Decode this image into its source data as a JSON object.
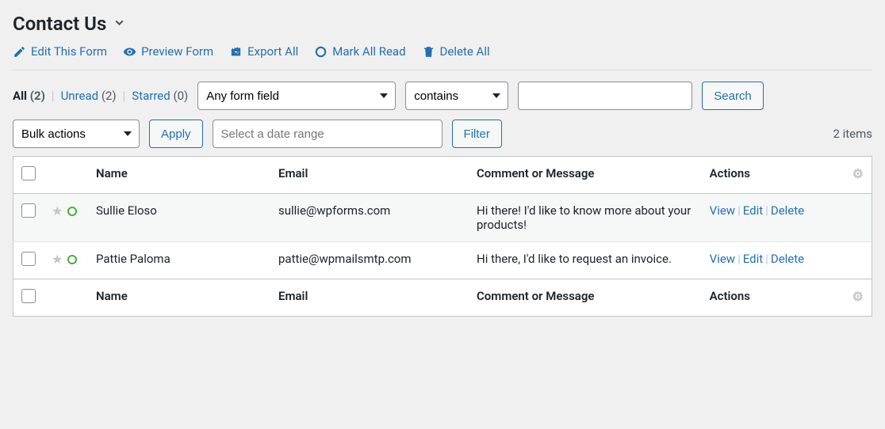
{
  "header": {
    "title": "Contact Us"
  },
  "toolbar": {
    "edit": "Edit This Form",
    "preview": "Preview Form",
    "export": "Export All",
    "mark_read": "Mark All Read",
    "delete_all": "Delete All"
  },
  "status": {
    "all_label": "All",
    "all_count": "(2)",
    "unread_label": "Unread",
    "unread_count": "(2)",
    "starred_label": "Starred",
    "starred_count": "(0)"
  },
  "search": {
    "field_option": "Any form field",
    "condition_option": "contains",
    "value": "",
    "button": "Search"
  },
  "bulk": {
    "label": "Bulk actions",
    "apply": "Apply",
    "date_placeholder": "Select a date range",
    "filter": "Filter"
  },
  "items_count": "2 items",
  "columns": {
    "name": "Name",
    "email": "Email",
    "message": "Comment or Message",
    "actions": "Actions"
  },
  "row_actions": {
    "view": "View",
    "edit": "Edit",
    "delete": "Delete"
  },
  "rows": [
    {
      "name": "Sullie Eloso",
      "email": "sullie@wpforms.com",
      "message": "Hi there! I'd like to know more about your products!"
    },
    {
      "name": "Pattie Paloma",
      "email": "pattie@wpmailsmtp.com",
      "message": "Hi there, I'd like to request an invoice."
    }
  ]
}
